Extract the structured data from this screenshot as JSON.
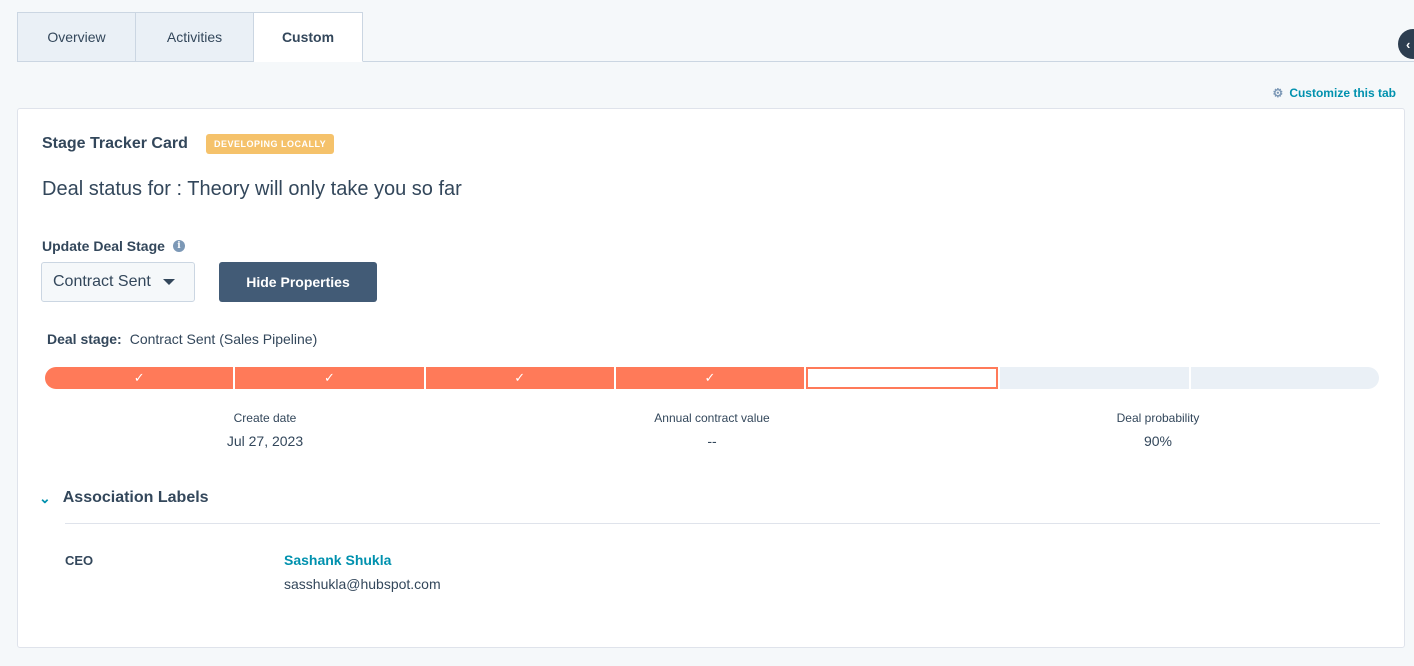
{
  "tabs": [
    {
      "label": "Overview"
    },
    {
      "label": "Activities"
    },
    {
      "label": "Custom"
    }
  ],
  "customize_tab": "Customize this tab",
  "card": {
    "title": "Stage Tracker Card",
    "badge": "DEVELOPING LOCALLY",
    "deal_status": "Deal status for : Theory will only take you so far",
    "update_label": "Update Deal Stage",
    "info_icon": "i",
    "stage_select_value": "Contract Sent",
    "hide_button": "Hide Properties",
    "deal_stage_key": "Deal stage:",
    "deal_stage_value": "Contract Sent (Sales Pipeline)",
    "progress": {
      "total_stages": 7,
      "completed_stages": 4,
      "current_stage_index": 5,
      "check_glyph": "✓"
    },
    "properties": [
      {
        "label": "Create date",
        "value": "Jul 27, 2023"
      },
      {
        "label": "Annual contract value",
        "value": "--"
      },
      {
        "label": "Deal probability",
        "value": "90%"
      }
    ],
    "association": {
      "heading": "Association Labels",
      "role": "CEO",
      "contact_name": "Sashank Shukla",
      "contact_email": "sasshukla@hubspot.com"
    }
  },
  "colors": {
    "accent": "#ff7a59",
    "link": "#0091ae",
    "primary_button": "#425b76",
    "badge": "#f5c26b"
  }
}
